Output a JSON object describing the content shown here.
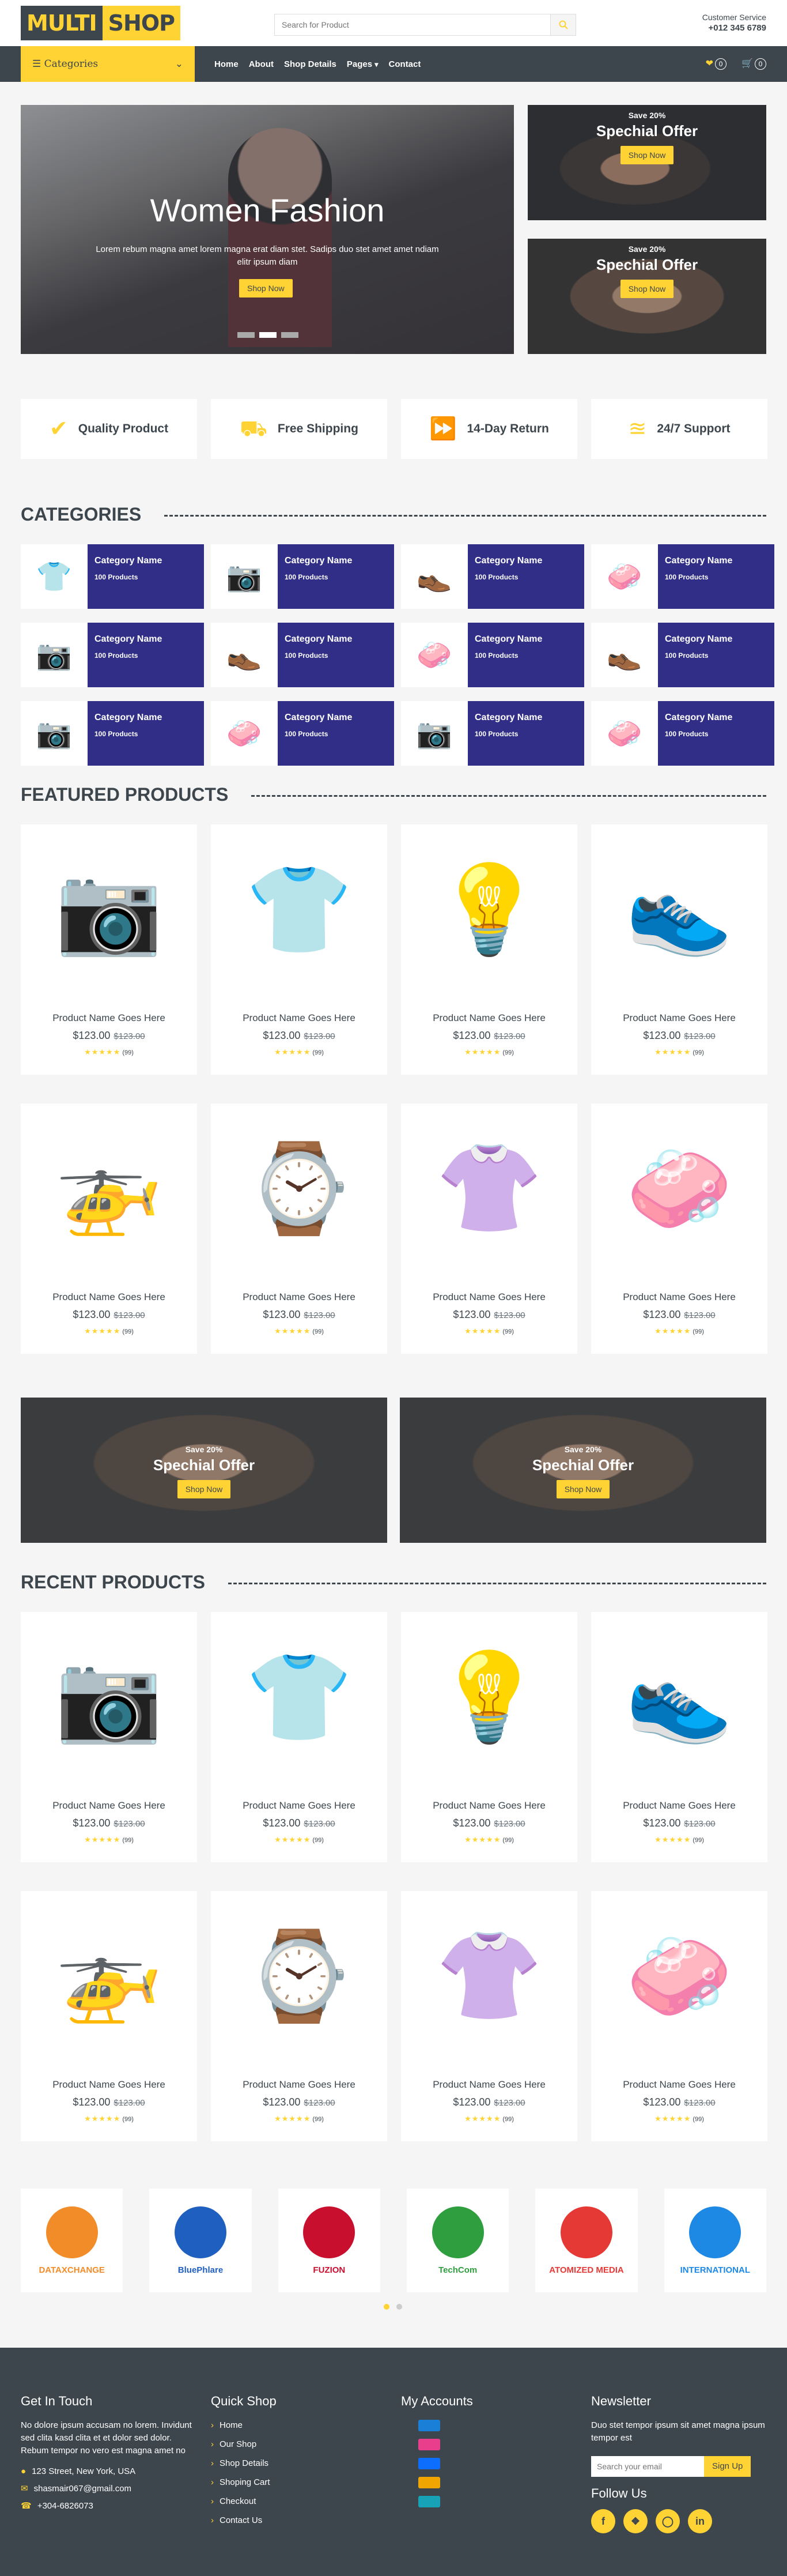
{
  "header": {
    "logo_part1": "MULTI",
    "logo_part2": "SHOP",
    "search_placeholder": "Search for Product",
    "cs_label": "Customer Service",
    "cs_phone": "+012 345 6789"
  },
  "nav": {
    "categories_label": "Categories",
    "menu": [
      "Home",
      "About",
      "Shop Details",
      "Pages",
      "Contact"
    ],
    "wishlist_count": "0",
    "cart_count": "0"
  },
  "hero": {
    "title": "Women Fashion",
    "text": "Lorem rebum magna amet lorem magna erat diam stet. Sadips duo stet amet amet ndiam elitr ipsum diam",
    "button": "Shop Now"
  },
  "offers": [
    {
      "save": "Save 20%",
      "title": "Spechial Offer",
      "button": "Shop Now"
    },
    {
      "save": "Save 20%",
      "title": "Spechial Offer",
      "button": "Shop Now"
    }
  ],
  "features": [
    {
      "icon": "check-icon",
      "label": "Quality Product"
    },
    {
      "icon": "truck-icon",
      "label": "Free Shipping"
    },
    {
      "icon": "exchange-icon",
      "label": "14-Day Return"
    },
    {
      "icon": "phone-signal-icon",
      "label": "24/7 Support"
    }
  ],
  "sections": {
    "categories": "CATEGORIES",
    "featured": "FEATURED PRODUCTS",
    "recent": "RECENT PRODUCTS"
  },
  "category_card": {
    "name": "Category Name",
    "count": "100 Products"
  },
  "categories": [
    "sweater",
    "camera",
    "shoe",
    "cosmetics",
    "camera",
    "shoe",
    "cosmetics",
    "shoe",
    "camera",
    "cosmetics",
    "camera",
    "cosmetics"
  ],
  "product": {
    "name": "Product Name Goes Here",
    "price": "$123.00",
    "old_price": "$123.00",
    "reviews": "(99)"
  },
  "featured_products": [
    "camera",
    "sweater",
    "lamp",
    "sneaker",
    "drone",
    "watch",
    "blouse",
    "cosmetics"
  ],
  "recent_products": [
    "camera",
    "sweater",
    "lamp",
    "sneaker",
    "drone",
    "watch",
    "blouse",
    "cosmetics"
  ],
  "vendors": [
    {
      "name": "DATAXCHANGE",
      "color": "#f28c28"
    },
    {
      "name": "BluePhlare",
      "color": "#1f5fbf"
    },
    {
      "name": "FUZION",
      "color": "#c8102e"
    },
    {
      "name": "TechCom",
      "color": "#2e9e3e"
    },
    {
      "name": "ATOMIZED MEDIA",
      "color": "#e53935"
    },
    {
      "name": "INTERNATIONAL",
      "color": "#1e88e5"
    }
  ],
  "footer": {
    "get_in_touch": "Get In Touch",
    "about": "No dolore ipsum accusam no lorem. Invidunt sed clita kasd clita et et dolor sed dolor. Rebum tempor no vero est magna amet no",
    "address": "123 Street, New York, USA",
    "email": "shasmair067@gmail.com",
    "phone": "+304-6826073",
    "quick_shop": "Quick Shop",
    "quick_links": [
      "Home",
      "Our Shop",
      "Shop Details",
      "Shoping Cart",
      "Checkout",
      "Contact Us"
    ],
    "my_accounts": "My Accounts",
    "newsletter": "Newsletter",
    "newsletter_text": "Duo stet tempor ipsum sit amet magna ipsum tempor est",
    "email_placeholder": "Search your email",
    "signup": "Sign Up",
    "follow_us": "Follow Us"
  },
  "colors": {
    "accent": "#ffd333",
    "dark": "#3d464d",
    "category_bg": "#302e87"
  }
}
